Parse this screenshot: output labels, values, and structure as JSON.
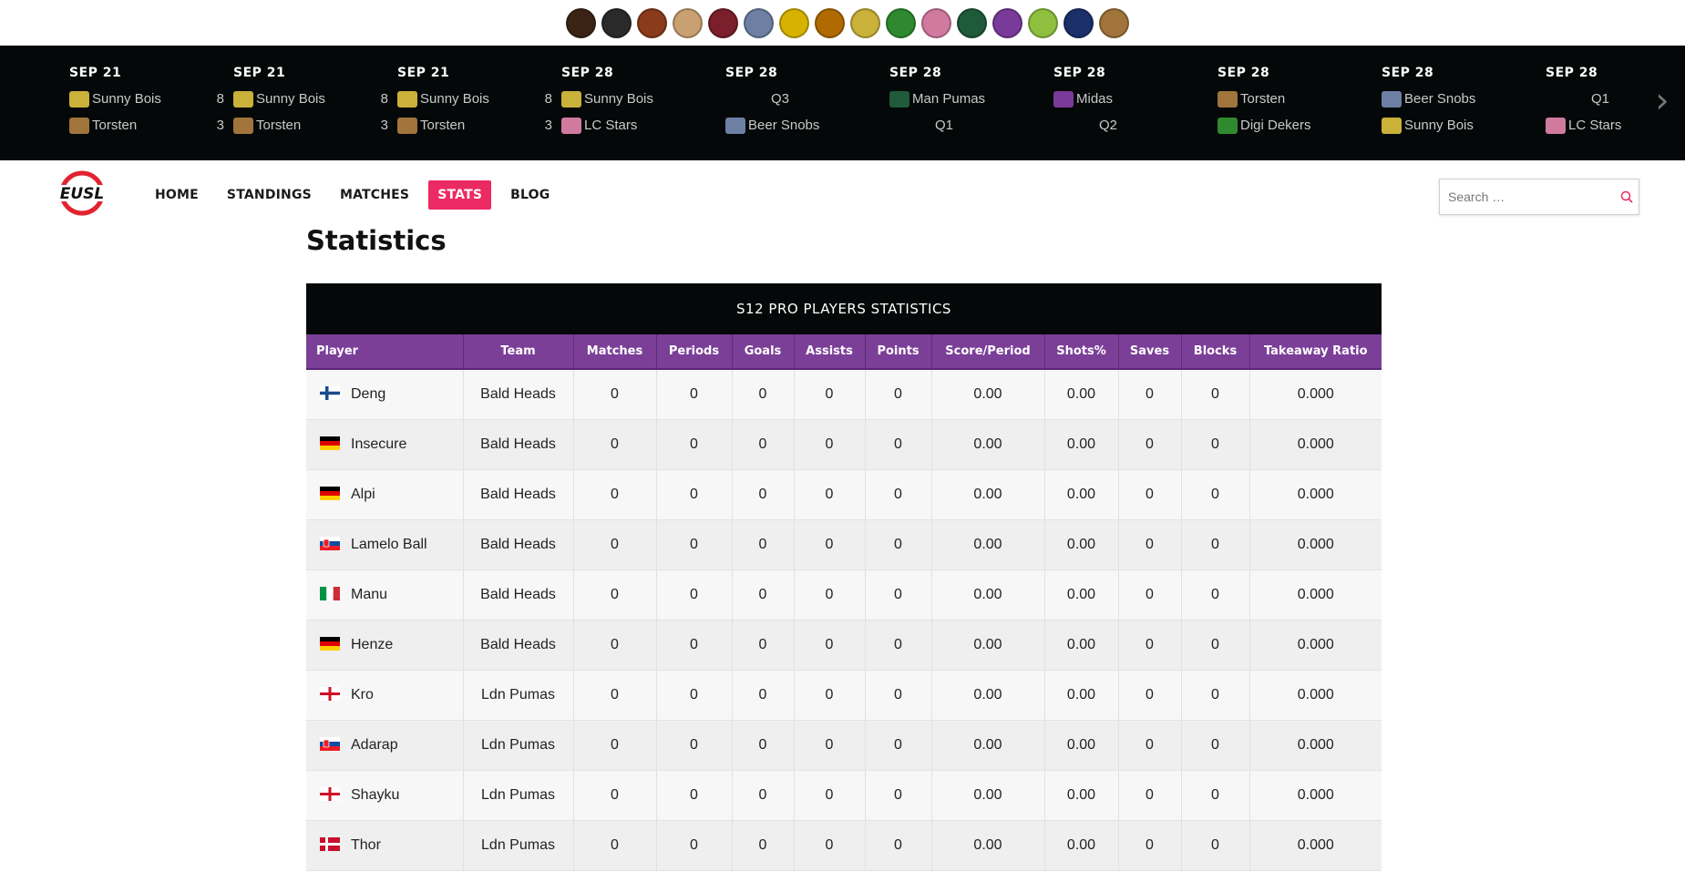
{
  "team_logos": [
    {
      "name": "bald-heads",
      "color": "#3b2416"
    },
    {
      "name": "monkey",
      "color": "#2a2a2a"
    },
    {
      "name": "tiger",
      "color": "#8a3b1b"
    },
    {
      "name": "bazar",
      "color": "#c9a072"
    },
    {
      "name": "ldn-pumas",
      "color": "#7a1f2b"
    },
    {
      "name": "beer-snobs",
      "color": "#6d7fa3"
    },
    {
      "name": "pucksters",
      "color": "#d6b300"
    },
    {
      "name": "lions",
      "color": "#b06a00"
    },
    {
      "name": "sunny-bois",
      "color": "#c9b13a"
    },
    {
      "name": "digi-dekers",
      "color": "#2f8a2f"
    },
    {
      "name": "lc-stars",
      "color": "#d17aa0"
    },
    {
      "name": "man-pumas",
      "color": "#1f5a3a"
    },
    {
      "name": "midas",
      "color": "#7a3a9a"
    },
    {
      "name": "green",
      "color": "#8fbf3f"
    },
    {
      "name": "blue-circle",
      "color": "#1b2f6b"
    },
    {
      "name": "torsten",
      "color": "#a0743b"
    }
  ],
  "ticker": {
    "matches": [
      {
        "date": "SEP 21",
        "home": "Sunny Bois",
        "home_score": "8",
        "home_logo": "#c9b13a",
        "away": "Torsten",
        "away_score": "3",
        "away_logo": "#a0743b"
      },
      {
        "date": "SEP 21",
        "home": "Sunny Bois",
        "home_score": "8",
        "home_logo": "#c9b13a",
        "away": "Torsten",
        "away_score": "3",
        "away_logo": "#a0743b"
      },
      {
        "date": "SEP 21",
        "home": "Sunny Bois",
        "home_score": "8",
        "home_logo": "#c9b13a",
        "away": "Torsten",
        "away_score": "3",
        "away_logo": "#a0743b"
      },
      {
        "date": "SEP 28",
        "home": "Sunny Bois",
        "home_score": "",
        "home_logo": "#c9b13a",
        "away": "LC Stars",
        "away_score": "",
        "away_logo": "#d17aa0"
      },
      {
        "date": "SEP 28",
        "home": "Q3",
        "home_score": "",
        "home_logo": "",
        "away": "Beer Snobs",
        "away_score": "",
        "away_logo": "#6d7fa3"
      },
      {
        "date": "SEP 28",
        "home": "Man Pumas",
        "home_score": "",
        "home_logo": "#1f5a3a",
        "away": "Q1",
        "away_score": "",
        "away_logo": ""
      },
      {
        "date": "SEP 28",
        "home": "Midas",
        "home_score": "",
        "home_logo": "#7a3a9a",
        "away": "Q2",
        "away_score": "",
        "away_logo": ""
      },
      {
        "date": "SEP 28",
        "home": "Torsten",
        "home_score": "",
        "home_logo": "#a0743b",
        "away": "Digi Dekers",
        "away_score": "",
        "away_logo": "#2f8a2f"
      },
      {
        "date": "SEP 28",
        "home": "Beer Snobs",
        "home_score": "",
        "home_logo": "#6d7fa3",
        "away": "Sunny Bois",
        "away_score": "",
        "away_logo": "#c9b13a"
      },
      {
        "date": "SEP 28",
        "home": "Q1",
        "home_score": "",
        "home_logo": "",
        "away": "LC Stars",
        "away_score": "",
        "away_logo": "#d17aa0"
      }
    ]
  },
  "nav": {
    "items": [
      "HOME",
      "STANDINGS",
      "MATCHES",
      "STATS",
      "BLOG"
    ],
    "active": "STATS",
    "active_color": "#ec2a63"
  },
  "search": {
    "placeholder": "Search …"
  },
  "page": {
    "title": "Statistics"
  },
  "stats_table": {
    "title": "S12 PRO PLAYERS STATISTICS",
    "header_color": "#7b3f98",
    "columns": [
      "Player",
      "Team",
      "Matches",
      "Periods",
      "Goals",
      "Assists",
      "Points",
      "Score/Period",
      "Shots%",
      "Saves",
      "Blocks",
      "Takeaway Ratio"
    ],
    "rows": [
      {
        "flag": "finland",
        "player": "Deng",
        "team": "Bald Heads",
        "matches": "0",
        "periods": "0",
        "goals": "0",
        "assists": "0",
        "points": "0",
        "score_period": "0.00",
        "shots_pct": "0.00",
        "saves": "0",
        "blocks": "0",
        "takeaway_ratio": "0.000"
      },
      {
        "flag": "germany",
        "player": "Insecure",
        "team": "Bald Heads",
        "matches": "0",
        "periods": "0",
        "goals": "0",
        "assists": "0",
        "points": "0",
        "score_period": "0.00",
        "shots_pct": "0.00",
        "saves": "0",
        "blocks": "0",
        "takeaway_ratio": "0.000"
      },
      {
        "flag": "germany",
        "player": "Alpi",
        "team": "Bald Heads",
        "matches": "0",
        "periods": "0",
        "goals": "0",
        "assists": "0",
        "points": "0",
        "score_period": "0.00",
        "shots_pct": "0.00",
        "saves": "0",
        "blocks": "0",
        "takeaway_ratio": "0.000"
      },
      {
        "flag": "slovakia",
        "player": "Lamelo Ball",
        "team": "Bald Heads",
        "matches": "0",
        "periods": "0",
        "goals": "0",
        "assists": "0",
        "points": "0",
        "score_period": "0.00",
        "shots_pct": "0.00",
        "saves": "0",
        "blocks": "0",
        "takeaway_ratio": "0.000"
      },
      {
        "flag": "italy",
        "player": "Manu",
        "team": "Bald Heads",
        "matches": "0",
        "periods": "0",
        "goals": "0",
        "assists": "0",
        "points": "0",
        "score_period": "0.00",
        "shots_pct": "0.00",
        "saves": "0",
        "blocks": "0",
        "takeaway_ratio": "0.000"
      },
      {
        "flag": "germany",
        "player": "Henze",
        "team": "Bald Heads",
        "matches": "0",
        "periods": "0",
        "goals": "0",
        "assists": "0",
        "points": "0",
        "score_period": "0.00",
        "shots_pct": "0.00",
        "saves": "0",
        "blocks": "0",
        "takeaway_ratio": "0.000"
      },
      {
        "flag": "england",
        "player": "Kro",
        "team": "Ldn Pumas",
        "matches": "0",
        "periods": "0",
        "goals": "0",
        "assists": "0",
        "points": "0",
        "score_period": "0.00",
        "shots_pct": "0.00",
        "saves": "0",
        "blocks": "0",
        "takeaway_ratio": "0.000"
      },
      {
        "flag": "slovakia",
        "player": "Adarap",
        "team": "Ldn Pumas",
        "matches": "0",
        "periods": "0",
        "goals": "0",
        "assists": "0",
        "points": "0",
        "score_period": "0.00",
        "shots_pct": "0.00",
        "saves": "0",
        "blocks": "0",
        "takeaway_ratio": "0.000"
      },
      {
        "flag": "england",
        "player": "Shayku",
        "team": "Ldn Pumas",
        "matches": "0",
        "periods": "0",
        "goals": "0",
        "assists": "0",
        "points": "0",
        "score_period": "0.00",
        "shots_pct": "0.00",
        "saves": "0",
        "blocks": "0",
        "takeaway_ratio": "0.000"
      },
      {
        "flag": "denmark",
        "player": "Thor",
        "team": "Ldn Pumas",
        "matches": "0",
        "periods": "0",
        "goals": "0",
        "assists": "0",
        "points": "0",
        "score_period": "0.00",
        "shots_pct": "0.00",
        "saves": "0",
        "blocks": "0",
        "takeaway_ratio": "0.000"
      }
    ]
  }
}
